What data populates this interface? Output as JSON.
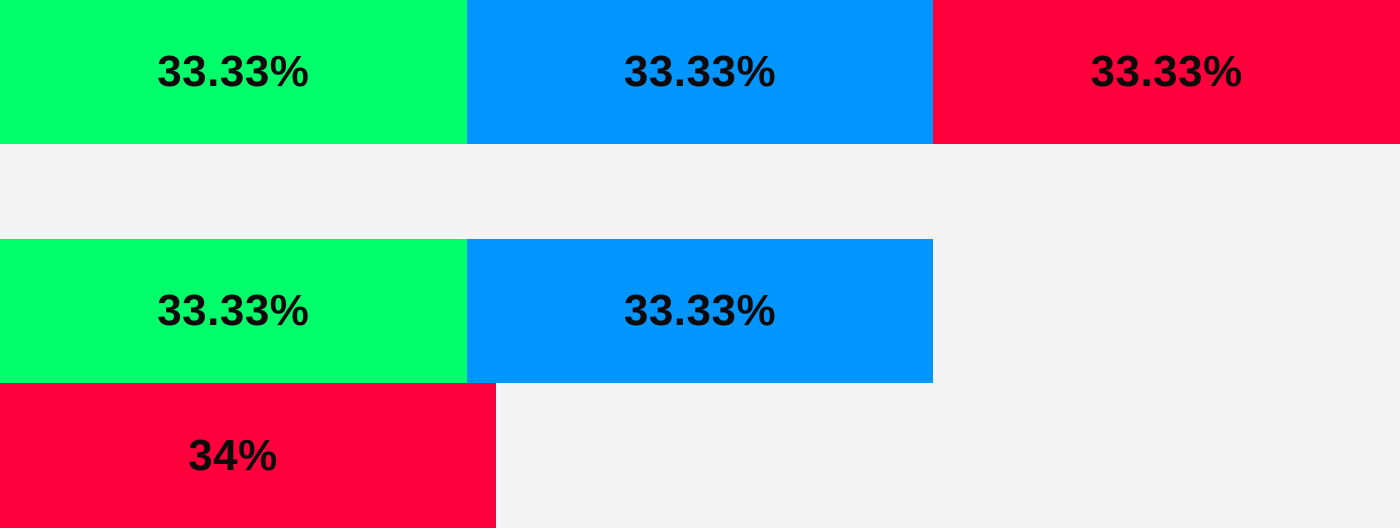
{
  "rows": [
    {
      "boxes": [
        {
          "label": "33.33%",
          "color": "#00ff6a",
          "width_percent": 33.33
        },
        {
          "label": "33.33%",
          "color": "#0095ff",
          "width_percent": 33.33
        },
        {
          "label": "33.33%",
          "color": "#ff003c",
          "width_percent": 33.33
        }
      ]
    },
    {
      "boxes": [
        {
          "label": "33.33%",
          "color": "#00ff6a",
          "width_percent": 33.33
        },
        {
          "label": "33.33%",
          "color": "#0095ff",
          "width_percent": 33.33
        },
        {
          "label": "34%",
          "color": "#ff003c",
          "width_percent": 34
        }
      ]
    }
  ],
  "colors": {
    "green": "#00ff6a",
    "blue": "#0095ff",
    "red": "#ff003c",
    "background": "#f4f4f4",
    "text": "#0a0a0a"
  }
}
